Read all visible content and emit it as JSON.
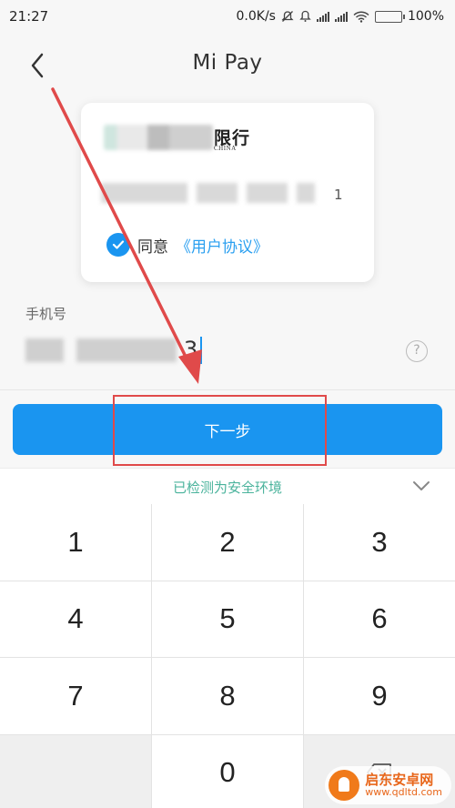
{
  "status_bar": {
    "time": "21:27",
    "network_speed": "0.0K/s",
    "battery": "100%",
    "battery_level": 1.0
  },
  "header": {
    "title": "Mi Pay"
  },
  "card": {
    "bank_name_visible": "限行",
    "bank_subtext_visible": "CHINA",
    "card_number_tail": "1",
    "agree_prefix": "同意",
    "agreement_link": "《用户协议》"
  },
  "phone": {
    "label": "手机号",
    "value_tail": "3",
    "help_label": "?"
  },
  "actions": {
    "next_label": "下一步"
  },
  "security": {
    "status_text": "已检测为安全环境"
  },
  "keypad": {
    "keys": [
      "1",
      "2",
      "3",
      "4",
      "5",
      "6",
      "7",
      "8",
      "9",
      "",
      "0",
      ""
    ]
  },
  "colors": {
    "primary": "#1a95f0",
    "secure_text": "#4ab39c",
    "annotation_red": "#e04a4a"
  },
  "icons": {
    "back": "chevron-left-icon",
    "check": "checkmark-circle-icon",
    "help": "question-circle-icon",
    "collapse": "chevron-down-icon",
    "delete": "backspace-icon"
  },
  "watermark": {
    "title": "启东安卓网",
    "url": "www.qdltd.com"
  }
}
